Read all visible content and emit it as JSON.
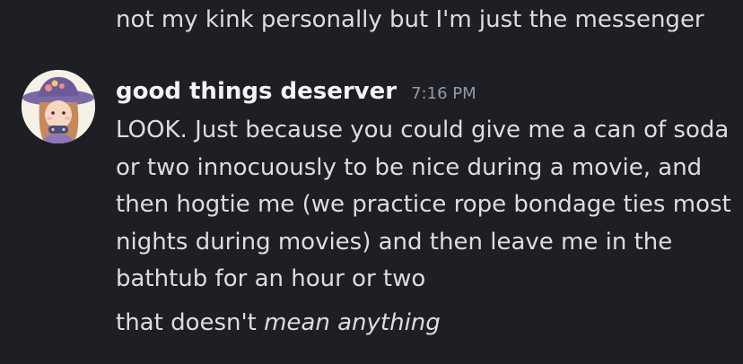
{
  "previous_message": {
    "text": "not my kink personally but I'm just the messenger"
  },
  "message": {
    "username": "good things deserver",
    "timestamp": "7:16 PM",
    "avatar_icon": "user-avatar-icon",
    "body": "LOOK. Just because you could give me a can of soda or two innocuously to be nice during a movie, and then hogtie me (we practice rope bondage ties most nights during movies) and then leave me in the bathtub for an hour or two",
    "followup_prefix": "that doesn't ",
    "followup_italic": "mean anything"
  },
  "colors": {
    "background": "#1e1f24",
    "text": "#dbdee1",
    "username": "#f2f3f5",
    "timestamp": "#949ba4"
  }
}
